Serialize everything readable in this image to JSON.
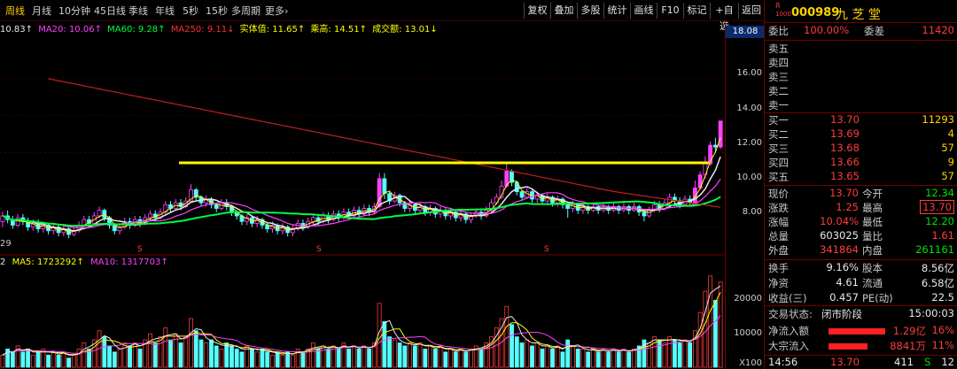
{
  "toolbar": {
    "tabs": [
      "周线",
      "月线",
      "10分钟",
      "45日线",
      "季线",
      "年线",
      "5秒",
      "15秒",
      "多周期",
      "更多›"
    ],
    "buttons": [
      "复权",
      "叠加",
      "多股",
      "统计",
      "画线",
      "F10",
      "标记",
      "+自选",
      "返回"
    ]
  },
  "ma_legend": {
    "ma10": "10.83↑",
    "ma20": "MA20: 10.06↑",
    "ma60": "MA60: 9.28↑",
    "ma250": "MA250: 9.11↓",
    "body": "实体值: 11.65↑",
    "mult": "乘高: 14.51↑",
    "amount": "成交额: 13.01↓"
  },
  "vol_legend": {
    "prefix": "2",
    "ma5": "MA5: 1723292↑",
    "ma10": "MA10: 1317703↑"
  },
  "left_edge_label": "29",
  "s_markers": [
    "S",
    "S",
    "S"
  ],
  "price_axis": {
    "top": "18.08",
    "ticks": [
      "16.00",
      "14.00",
      "12.00",
      "10.00",
      "8.00"
    ]
  },
  "vol_axis": {
    "ticks": [
      "20000",
      "10000"
    ],
    "unit": "X100"
  },
  "stock": {
    "badge_top": "R",
    "badge_bottom": "1000",
    "code": "000989",
    "name": "九 芝 堂"
  },
  "ratio": {
    "label": "委比",
    "value": "100.00%",
    "label2": "委差",
    "value2": "11420"
  },
  "asks": [
    {
      "label": "卖五",
      "price": "",
      "vol": ""
    },
    {
      "label": "卖四",
      "price": "",
      "vol": ""
    },
    {
      "label": "卖三",
      "price": "",
      "vol": ""
    },
    {
      "label": "卖二",
      "price": "",
      "vol": ""
    },
    {
      "label": "卖一",
      "price": "",
      "vol": ""
    }
  ],
  "bids": [
    {
      "label": "买一",
      "price": "13.70",
      "vol": "11293"
    },
    {
      "label": "买二",
      "price": "13.69",
      "vol": "4"
    },
    {
      "label": "买三",
      "price": "13.68",
      "vol": "57"
    },
    {
      "label": "买四",
      "price": "13.66",
      "vol": "9"
    },
    {
      "label": "买五",
      "price": "13.65",
      "vol": "57"
    }
  ],
  "quote": [
    {
      "l1": "现价",
      "v1": "13.70",
      "c1": "red",
      "l2": "今开",
      "v2": "12.34",
      "c2": "green"
    },
    {
      "l1": "涨跌",
      "v1": "1.25",
      "c1": "red",
      "l2": "最高",
      "v2": "13.70",
      "c2": "red"
    },
    {
      "l1": "涨幅",
      "v1": "10.04%",
      "c1": "red",
      "l2": "最低",
      "v2": "12.20",
      "c2": "green"
    },
    {
      "l1": "总量",
      "v1": "603025",
      "c1": "white",
      "l2": "量比",
      "v2": "1.61",
      "c2": "red"
    },
    {
      "l1": "外盘",
      "v1": "341864",
      "c1": "red",
      "l2": "内盘",
      "v2": "261161",
      "c2": "green"
    }
  ],
  "fundamentals": [
    {
      "l1": "换手",
      "v1": "9.16%",
      "l2": "股本",
      "v2": "8.56亿"
    },
    {
      "l1": "净资",
      "v1": "4.61",
      "l2": "流通",
      "v2": "6.58亿"
    },
    {
      "l1": "收益(三)",
      "v1": "0.457",
      "l2": "PE(动)",
      "v2": "22.5"
    }
  ],
  "status": {
    "label": "交易状态:",
    "value": "闭市阶段",
    "time": "15:00:03"
  },
  "flows": [
    {
      "label": "净流入额",
      "value": "1.29亿",
      "pct": "16%",
      "fill": 0.16
    },
    {
      "label": "大宗流入",
      "value": "8841万",
      "pct": "11%",
      "fill": 0.11
    }
  ],
  "tick": {
    "time": "14:56",
    "price": "13.70",
    "vol": "411",
    "side": "S",
    "count": "12"
  },
  "chart_data": {
    "type": "candlestick",
    "price_ticks": [
      16.0,
      14.0,
      12.0,
      10.0,
      8.0
    ],
    "price_top": 18.08,
    "ylim": [
      6.6,
      18.3
    ],
    "resistance_line": 11.45,
    "candles": [
      [
        8.3,
        8.6,
        8.0,
        8.8
      ],
      [
        8.6,
        8.4,
        8.2,
        8.9
      ],
      [
        8.4,
        8.1,
        7.9,
        8.6
      ],
      [
        8.1,
        8.5,
        8.0,
        8.7
      ],
      [
        8.5,
        8.3,
        8.1,
        8.7
      ],
      [
        8.3,
        8.0,
        7.8,
        8.5
      ],
      [
        8.0,
        8.2,
        7.8,
        8.4
      ],
      [
        8.2,
        7.9,
        7.7,
        8.4
      ],
      [
        7.9,
        8.1,
        7.7,
        8.3
      ],
      [
        8.1,
        7.8,
        7.6,
        8.2
      ],
      [
        7.8,
        8.0,
        7.6,
        8.2
      ],
      [
        8.0,
        7.7,
        7.5,
        8.1
      ],
      [
        7.7,
        7.9,
        7.5,
        8.1
      ],
      [
        7.9,
        7.6,
        7.4,
        8.0
      ],
      [
        7.6,
        7.8,
        7.5,
        8.0
      ],
      [
        7.8,
        8.1,
        7.7,
        8.3
      ],
      [
        8.1,
        8.4,
        8.0,
        8.6
      ],
      [
        8.4,
        8.2,
        8.0,
        8.6
      ],
      [
        8.2,
        8.6,
        8.1,
        8.8
      ],
      [
        8.6,
        8.9,
        8.5,
        9.1
      ],
      [
        8.9,
        8.5,
        8.3,
        9.0
      ],
      [
        8.5,
        8.1,
        7.9,
        8.6
      ],
      [
        8.1,
        7.8,
        7.6,
        8.2
      ],
      [
        7.8,
        8.0,
        7.6,
        8.2
      ],
      [
        8.0,
        8.3,
        7.9,
        8.5
      ],
      [
        8.3,
        8.1,
        7.9,
        8.5
      ],
      [
        8.1,
        8.4,
        8.0,
        8.6
      ],
      [
        8.4,
        8.2,
        8.0,
        8.6
      ],
      [
        8.2,
        8.5,
        8.1,
        8.7
      ],
      [
        8.5,
        8.7,
        8.4,
        8.9
      ],
      [
        8.7,
        8.5,
        8.3,
        8.9
      ],
      [
        8.5,
        8.8,
        8.4,
        9.0
      ],
      [
        8.8,
        9.2,
        8.7,
        9.4
      ],
      [
        9.2,
        9.0,
        8.8,
        9.4
      ],
      [
        9.0,
        9.3,
        8.9,
        9.5
      ],
      [
        9.3,
        9.1,
        8.9,
        9.5
      ],
      [
        9.1,
        9.4,
        9.0,
        9.6
      ],
      [
        9.4,
        10.0,
        9.3,
        10.3
      ],
      [
        10.0,
        9.6,
        9.4,
        10.1
      ],
      [
        9.6,
        9.3,
        9.1,
        9.7
      ],
      [
        9.3,
        9.5,
        9.1,
        9.7
      ],
      [
        9.5,
        9.2,
        9.0,
        9.6
      ],
      [
        9.2,
        9.0,
        8.8,
        9.3
      ],
      [
        9.0,
        9.3,
        8.9,
        9.5
      ],
      [
        9.3,
        9.1,
        8.9,
        9.5
      ],
      [
        9.1,
        8.8,
        8.6,
        9.2
      ],
      [
        8.8,
        8.6,
        8.4,
        8.9
      ],
      [
        8.6,
        8.3,
        8.1,
        8.7
      ],
      [
        8.3,
        8.5,
        8.1,
        8.7
      ],
      [
        8.5,
        8.2,
        8.0,
        8.6
      ],
      [
        8.2,
        8.4,
        8.0,
        8.6
      ],
      [
        8.4,
        8.1,
        7.9,
        8.5
      ],
      [
        8.1,
        7.9,
        7.7,
        8.2
      ],
      [
        7.9,
        8.1,
        7.7,
        8.3
      ],
      [
        8.1,
        7.8,
        7.6,
        8.2
      ],
      [
        7.8,
        8.0,
        7.6,
        8.2
      ],
      [
        8.0,
        7.7,
        7.5,
        8.1
      ],
      [
        7.7,
        7.9,
        7.5,
        8.1
      ],
      [
        7.9,
        8.2,
        7.8,
        8.4
      ],
      [
        8.2,
        8.0,
        7.8,
        8.4
      ],
      [
        8.0,
        8.3,
        7.9,
        8.5
      ],
      [
        8.3,
        8.5,
        8.1,
        8.7
      ],
      [
        8.5,
        8.3,
        8.1,
        8.7
      ],
      [
        8.3,
        8.6,
        8.2,
        8.8
      ],
      [
        8.6,
        8.4,
        8.2,
        8.8
      ],
      [
        8.4,
        8.7,
        8.3,
        8.9
      ],
      [
        8.7,
        8.5,
        8.3,
        8.9
      ],
      [
        8.5,
        8.8,
        8.4,
        9.0
      ],
      [
        8.8,
        8.6,
        8.4,
        9.0
      ],
      [
        8.6,
        8.9,
        8.5,
        9.1
      ],
      [
        8.9,
        8.7,
        8.5,
        9.1
      ],
      [
        8.7,
        9.0,
        8.6,
        9.2
      ],
      [
        9.0,
        8.8,
        8.6,
        9.2
      ],
      [
        8.8,
        9.1,
        8.7,
        9.3
      ],
      [
        9.1,
        10.6,
        9.0,
        10.9
      ],
      [
        10.6,
        9.8,
        9.5,
        10.9
      ],
      [
        9.8,
        9.4,
        9.2,
        9.9
      ],
      [
        9.4,
        9.7,
        9.3,
        9.9
      ],
      [
        9.7,
        9.3,
        9.1,
        9.8
      ],
      [
        9.3,
        9.0,
        8.8,
        9.4
      ],
      [
        9.0,
        9.2,
        8.8,
        9.4
      ],
      [
        9.2,
        8.9,
        8.7,
        9.3
      ],
      [
        8.9,
        9.1,
        8.7,
        9.3
      ],
      [
        9.1,
        8.8,
        8.6,
        9.2
      ],
      [
        8.8,
        9.0,
        8.6,
        9.2
      ],
      [
        9.0,
        8.7,
        8.5,
        9.1
      ],
      [
        8.7,
        8.9,
        8.5,
        9.1
      ],
      [
        8.9,
        8.6,
        8.4,
        9.0
      ],
      [
        8.6,
        8.8,
        8.4,
        9.0
      ],
      [
        8.8,
        8.5,
        8.3,
        8.9
      ],
      [
        8.5,
        8.7,
        8.3,
        8.9
      ],
      [
        8.7,
        8.4,
        8.2,
        8.8
      ],
      [
        8.4,
        8.6,
        8.2,
        8.8
      ],
      [
        8.6,
        8.8,
        8.5,
        9.0
      ],
      [
        8.8,
        8.6,
        8.4,
        9.0
      ],
      [
        8.6,
        8.9,
        8.5,
        9.1
      ],
      [
        8.9,
        9.3,
        8.8,
        9.5
      ],
      [
        9.3,
        9.6,
        9.2,
        9.8
      ],
      [
        9.6,
        10.2,
        9.5,
        10.5
      ],
      [
        10.2,
        11.0,
        10.1,
        11.4
      ],
      [
        11.0,
        10.4,
        10.2,
        11.1
      ],
      [
        10.4,
        9.9,
        9.7,
        10.5
      ],
      [
        9.9,
        9.6,
        9.4,
        10.0
      ],
      [
        9.6,
        9.9,
        9.5,
        10.1
      ],
      [
        9.9,
        9.5,
        9.3,
        10.0
      ],
      [
        9.5,
        9.7,
        9.3,
        9.9
      ],
      [
        9.7,
        9.4,
        9.2,
        9.8
      ],
      [
        9.4,
        9.6,
        9.2,
        9.8
      ],
      [
        9.6,
        9.3,
        9.1,
        9.7
      ],
      [
        9.3,
        9.5,
        9.1,
        9.7
      ],
      [
        9.5,
        9.2,
        9.0,
        9.6
      ],
      [
        9.2,
        9.0,
        8.5,
        9.3
      ],
      [
        9.0,
        9.2,
        8.8,
        9.4
      ],
      [
        9.2,
        8.9,
        8.7,
        9.3
      ],
      [
        8.9,
        9.1,
        8.7,
        9.3
      ],
      [
        9.1,
        8.9,
        8.7,
        9.2
      ],
      [
        8.9,
        9.1,
        8.8,
        9.3
      ],
      [
        9.1,
        8.9,
        8.7,
        9.2
      ],
      [
        8.9,
        9.1,
        8.8,
        9.3
      ],
      [
        9.1,
        8.9,
        8.7,
        9.2
      ],
      [
        8.9,
        9.1,
        8.8,
        9.3
      ],
      [
        9.1,
        8.9,
        8.7,
        9.2
      ],
      [
        8.9,
        9.1,
        8.8,
        9.3
      ],
      [
        9.1,
        8.9,
        8.7,
        9.2
      ],
      [
        8.9,
        9.1,
        8.8,
        9.3
      ],
      [
        9.1,
        8.8,
        8.6,
        9.2
      ],
      [
        8.8,
        8.6,
        8.3,
        8.9
      ],
      [
        8.6,
        8.9,
        8.5,
        9.1
      ],
      [
        8.9,
        9.2,
        8.8,
        9.4
      ],
      [
        9.2,
        9.0,
        8.8,
        9.4
      ],
      [
        9.0,
        9.3,
        8.9,
        9.5
      ],
      [
        9.3,
        9.6,
        9.2,
        9.8
      ],
      [
        9.6,
        9.4,
        9.2,
        9.8
      ],
      [
        9.4,
        9.2,
        9.0,
        9.6
      ],
      [
        9.2,
        9.5,
        9.1,
        9.7
      ],
      [
        9.5,
        9.3,
        9.1,
        9.7
      ],
      [
        9.3,
        10.1,
        9.2,
        10.5
      ],
      [
        10.1,
        10.8,
        10.0,
        11.0
      ],
      [
        10.8,
        11.4,
        10.6,
        11.8
      ],
      [
        11.4,
        12.4,
        11.3,
        12.6
      ],
      [
        12.4,
        12.3,
        12.0,
        12.8
      ],
      [
        12.3,
        13.7,
        12.2,
        13.7
      ]
    ],
    "volume": [
      4,
      6,
      5,
      7,
      5,
      6,
      4,
      5,
      6,
      4,
      5,
      4,
      5,
      3,
      4,
      6,
      8,
      6,
      9,
      12,
      10,
      7,
      5,
      6,
      8,
      7,
      8,
      6,
      9,
      11,
      8,
      10,
      13,
      9,
      11,
      8,
      10,
      16,
      12,
      9,
      8,
      9,
      7,
      6,
      8,
      7,
      6,
      5,
      7,
      6,
      5,
      6,
      5,
      4,
      5,
      4,
      5,
      4,
      6,
      5,
      6,
      8,
      6,
      7,
      6,
      7,
      6,
      8,
      6,
      7,
      6,
      7,
      6,
      8,
      21,
      15,
      10,
      9,
      8,
      7,
      8,
      7,
      8,
      6,
      7,
      6,
      7,
      5,
      6,
      5,
      6,
      5,
      6,
      7,
      6,
      8,
      10,
      13,
      16,
      20,
      14,
      10,
      8,
      9,
      7,
      8,
      6,
      7,
      6,
      7,
      5,
      9,
      7,
      6,
      6,
      5,
      6,
      5,
      6,
      5,
      6,
      5,
      6,
      5,
      6,
      7,
      9,
      8,
      10,
      9,
      8,
      10,
      9,
      8,
      9,
      8,
      12,
      18,
      25,
      30,
      22,
      28
    ]
  }
}
